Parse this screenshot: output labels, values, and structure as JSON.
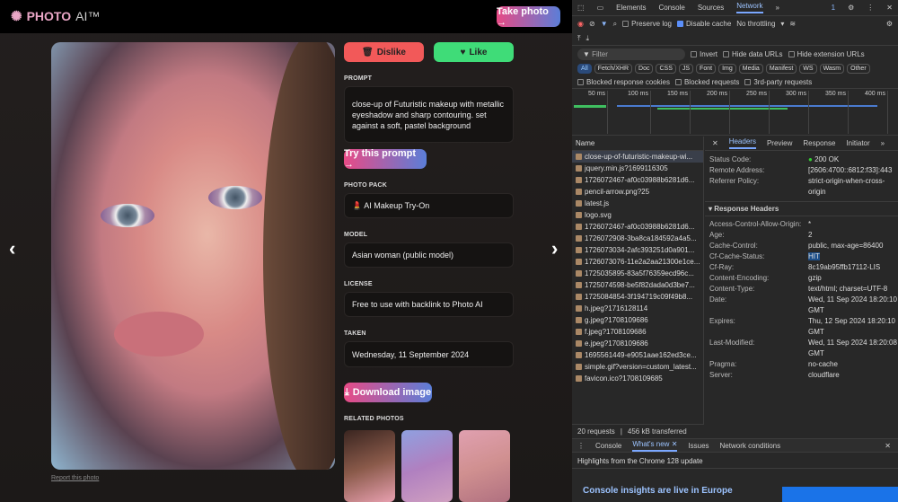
{
  "site": {
    "brand": "PHOTO",
    "brand_suffix": "AI™",
    "take_photo": "Take photo →",
    "dislike": "Dislike",
    "like": "Like",
    "prompt_label": "PROMPT",
    "prompt": "close-up of Futuristic makeup with metallic eyeshadow and sharp contouring. set against a soft, pastel background",
    "try_prompt": "Try this prompt →",
    "pack_label": "PHOTO PACK",
    "pack": "💄 AI Makeup Try-On",
    "model_label": "MODEL",
    "model": "Asian woman (public model)",
    "license_label": "LICENSE",
    "license": "Free to use with backlink to Photo AI",
    "taken_label": "TAKEN",
    "taken": "Wednesday, 11 September 2024",
    "download": "Download image",
    "related_label": "RELATED PHOTOS",
    "report": "Report this photo",
    "prev": "‹",
    "next": "›"
  },
  "devtools": {
    "tabs": [
      "Elements",
      "Console",
      "Sources",
      "Network"
    ],
    "active_tab": "Network",
    "issues_count": "1",
    "preserve_log": "Preserve log",
    "disable_cache": "Disable cache",
    "throttling": "No throttling",
    "filter_placeholder": "Filter",
    "invert": "Invert",
    "hide_data": "Hide data URLs",
    "hide_ext": "Hide extension URLs",
    "types": [
      "All",
      "Fetch/XHR",
      "Doc",
      "CSS",
      "JS",
      "Font",
      "Img",
      "Media",
      "Manifest",
      "WS",
      "Wasm",
      "Other"
    ],
    "blocked_cookies": "Blocked response cookies",
    "blocked_requests": "Blocked requests",
    "third_party": "3rd-party requests",
    "timeline": [
      "50 ms",
      "100 ms",
      "150 ms",
      "200 ms",
      "250 ms",
      "300 ms",
      "350 ms",
      "400 ms"
    ],
    "name_header": "Name",
    "requests": [
      "close-up-of-futuristic-makeup-wi...",
      "jquery.min.js?1699116305",
      "1726072467-af0c03988b6281d6...",
      "pencil-arrow.png?25",
      "latest.js",
      "logo.svg",
      "1726072467-af0c03988b6281d6...",
      "1726072908-3ba8ca184592a4a5...",
      "1726073034-2afc393251d0a901...",
      "1726073076-11e2a2aa21300e1ce...",
      "1725035895-83a5f76359ecd96c...",
      "1725074598-be5f82dada0d3be7...",
      "1725084854-3f194719c09f49b8...",
      "h.jpeg?1716128114",
      "g.jpeg?1708109686",
      "f.jpeg?1708109686",
      "e.jpeg?1708109686",
      "1695561449-e9051aae162ed3ce...",
      "simple.gif?version=custom_latest...",
      "favicon.ico?1708109685"
    ],
    "detail_tabs": [
      "Headers",
      "Preview",
      "Response",
      "Initiator"
    ],
    "general": [
      {
        "k": "Status Code:",
        "v": "200 OK"
      },
      {
        "k": "Remote Address:",
        "v": "[2606:4700::6812:f33]:443"
      },
      {
        "k": "Referrer Policy:",
        "v": "strict-origin-when-cross-origin"
      }
    ],
    "response_headers_label": "▾ Response Headers",
    "response_headers": [
      {
        "k": "Access-Control-Allow-Origin:",
        "v": "*"
      },
      {
        "k": "Age:",
        "v": "2"
      },
      {
        "k": "Cache-Control:",
        "v": "public, max-age=86400"
      },
      {
        "k": "Cf-Cache-Status:",
        "v": "HIT"
      },
      {
        "k": "Cf-Ray:",
        "v": "8c19ab95ffb17112-LIS"
      },
      {
        "k": "Content-Encoding:",
        "v": "gzip"
      },
      {
        "k": "Content-Type:",
        "v": "text/html; charset=UTF-8"
      },
      {
        "k": "Date:",
        "v": "Wed, 11 Sep 2024 18:20:10 GMT"
      },
      {
        "k": "Expires:",
        "v": "Thu, 12 Sep 2024 18:20:10 GMT"
      },
      {
        "k": "Last-Modified:",
        "v": "Wed, 11 Sep 2024 18:20:08 GMT"
      },
      {
        "k": "Pragma:",
        "v": "no-cache"
      },
      {
        "k": "Server:",
        "v": "cloudflare"
      }
    ],
    "status_requests": "20 requests",
    "status_transferred": "456 kB transferred",
    "drawer_tabs": [
      "Console",
      "What's new",
      "Issues",
      "Network conditions"
    ],
    "highlights": "Highlights from the Chrome 128 update",
    "insights": "Console insights are live in Europe"
  }
}
